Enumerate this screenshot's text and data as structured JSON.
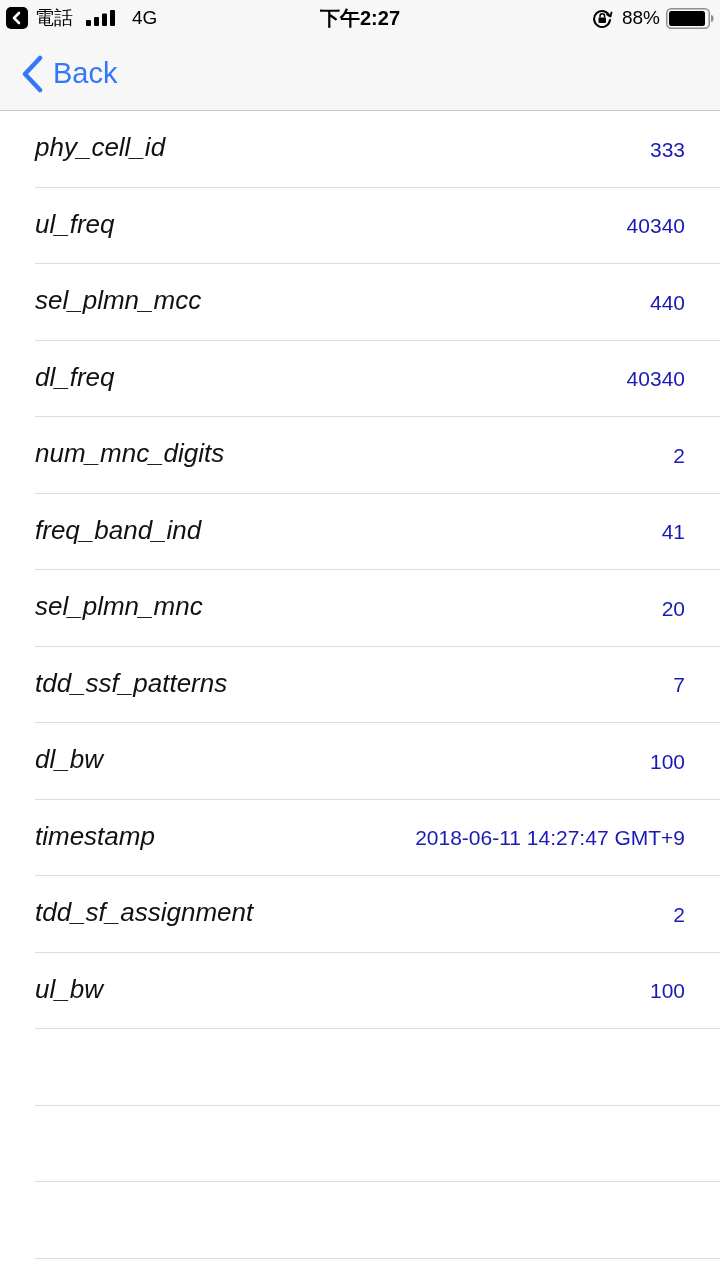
{
  "status_bar": {
    "app_label": "電話",
    "network": "4G",
    "time": "下午2:27",
    "battery": "88%"
  },
  "nav_bar": {
    "back_label": "Back"
  },
  "rows": [
    {
      "name": "phy_cell_id",
      "value": "333"
    },
    {
      "name": "ul_freq",
      "value": "40340"
    },
    {
      "name": "sel_plmn_mcc",
      "value": "440"
    },
    {
      "name": "dl_freq",
      "value": "40340"
    },
    {
      "name": "num_mnc_digits",
      "value": "2"
    },
    {
      "name": "freq_band_ind",
      "value": "41"
    },
    {
      "name": "sel_plmn_mnc",
      "value": "20"
    },
    {
      "name": "tdd_ssf_patterns",
      "value": "7"
    },
    {
      "name": "dl_bw",
      "value": "100"
    },
    {
      "name": "timestamp",
      "value": "2018-06-11 14:27:47 GMT+9"
    },
    {
      "name": "tdd_sf_assignment",
      "value": "2"
    },
    {
      "name": "ul_bw",
      "value": "100"
    }
  ]
}
